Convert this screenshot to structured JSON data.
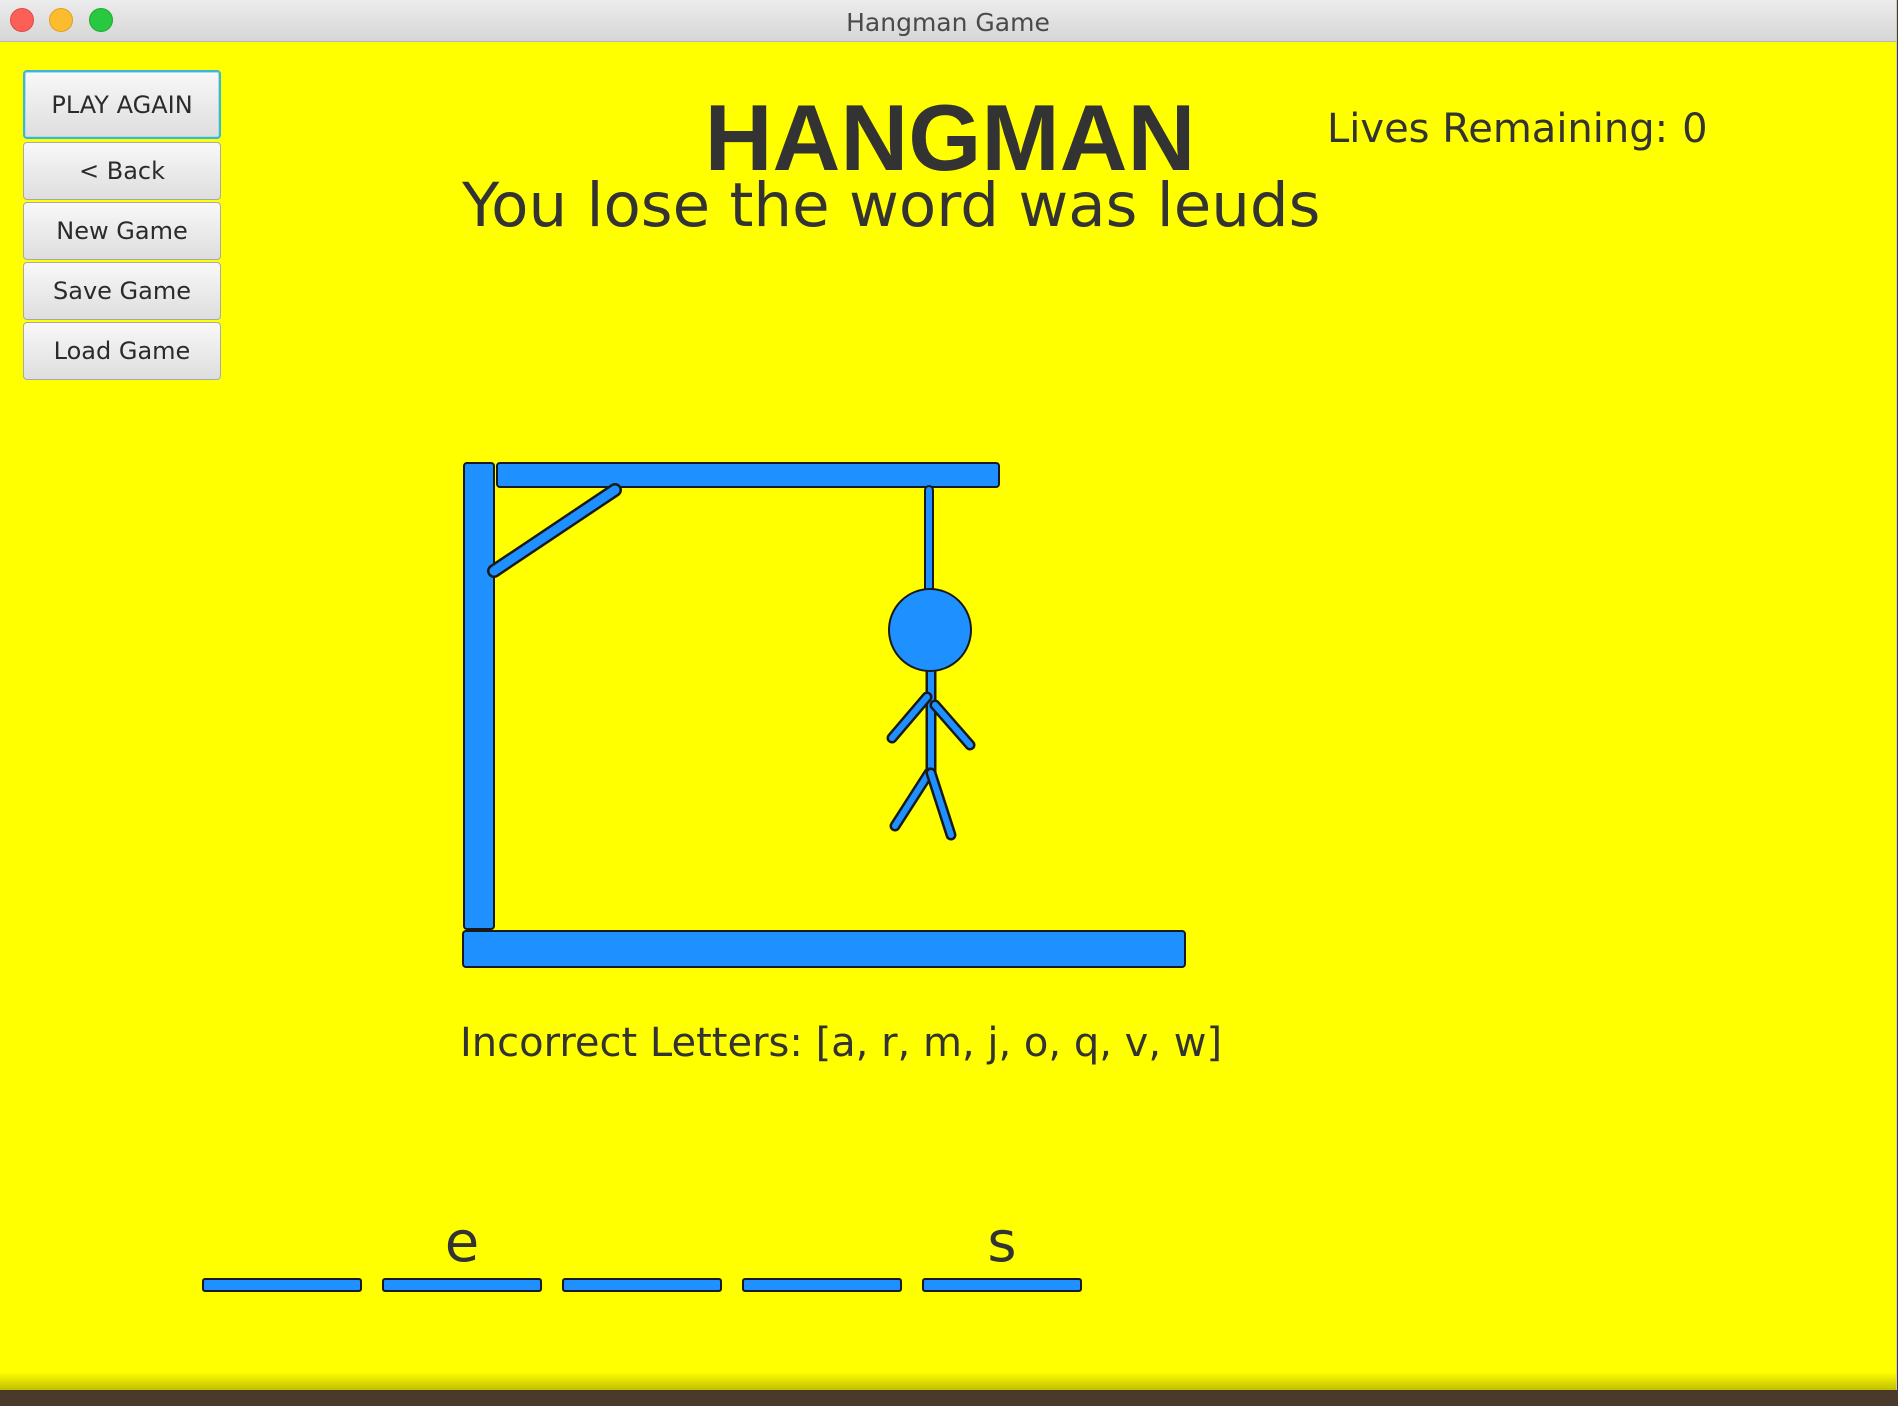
{
  "window": {
    "title": "Hangman Game"
  },
  "sidebar": {
    "play_again": "PLAY AGAIN",
    "back": "< Back",
    "new_game": "New Game",
    "save_game": "Save Game",
    "load_game": "Load Game"
  },
  "header": {
    "title": "HANGMAN",
    "status": "You lose the word was leuds",
    "lives_label": "Lives Remaining:",
    "lives_value": "0"
  },
  "game": {
    "incorrect_letters": "Incorrect Letters: [a, r, m, j, o, q, v, w]",
    "word_slots": [
      "",
      "e",
      "",
      "",
      "s"
    ]
  },
  "colors": {
    "background": "#ffff00",
    "drawing": "#1e90ff",
    "outline": "#1a1a1a",
    "text": "#333333"
  }
}
